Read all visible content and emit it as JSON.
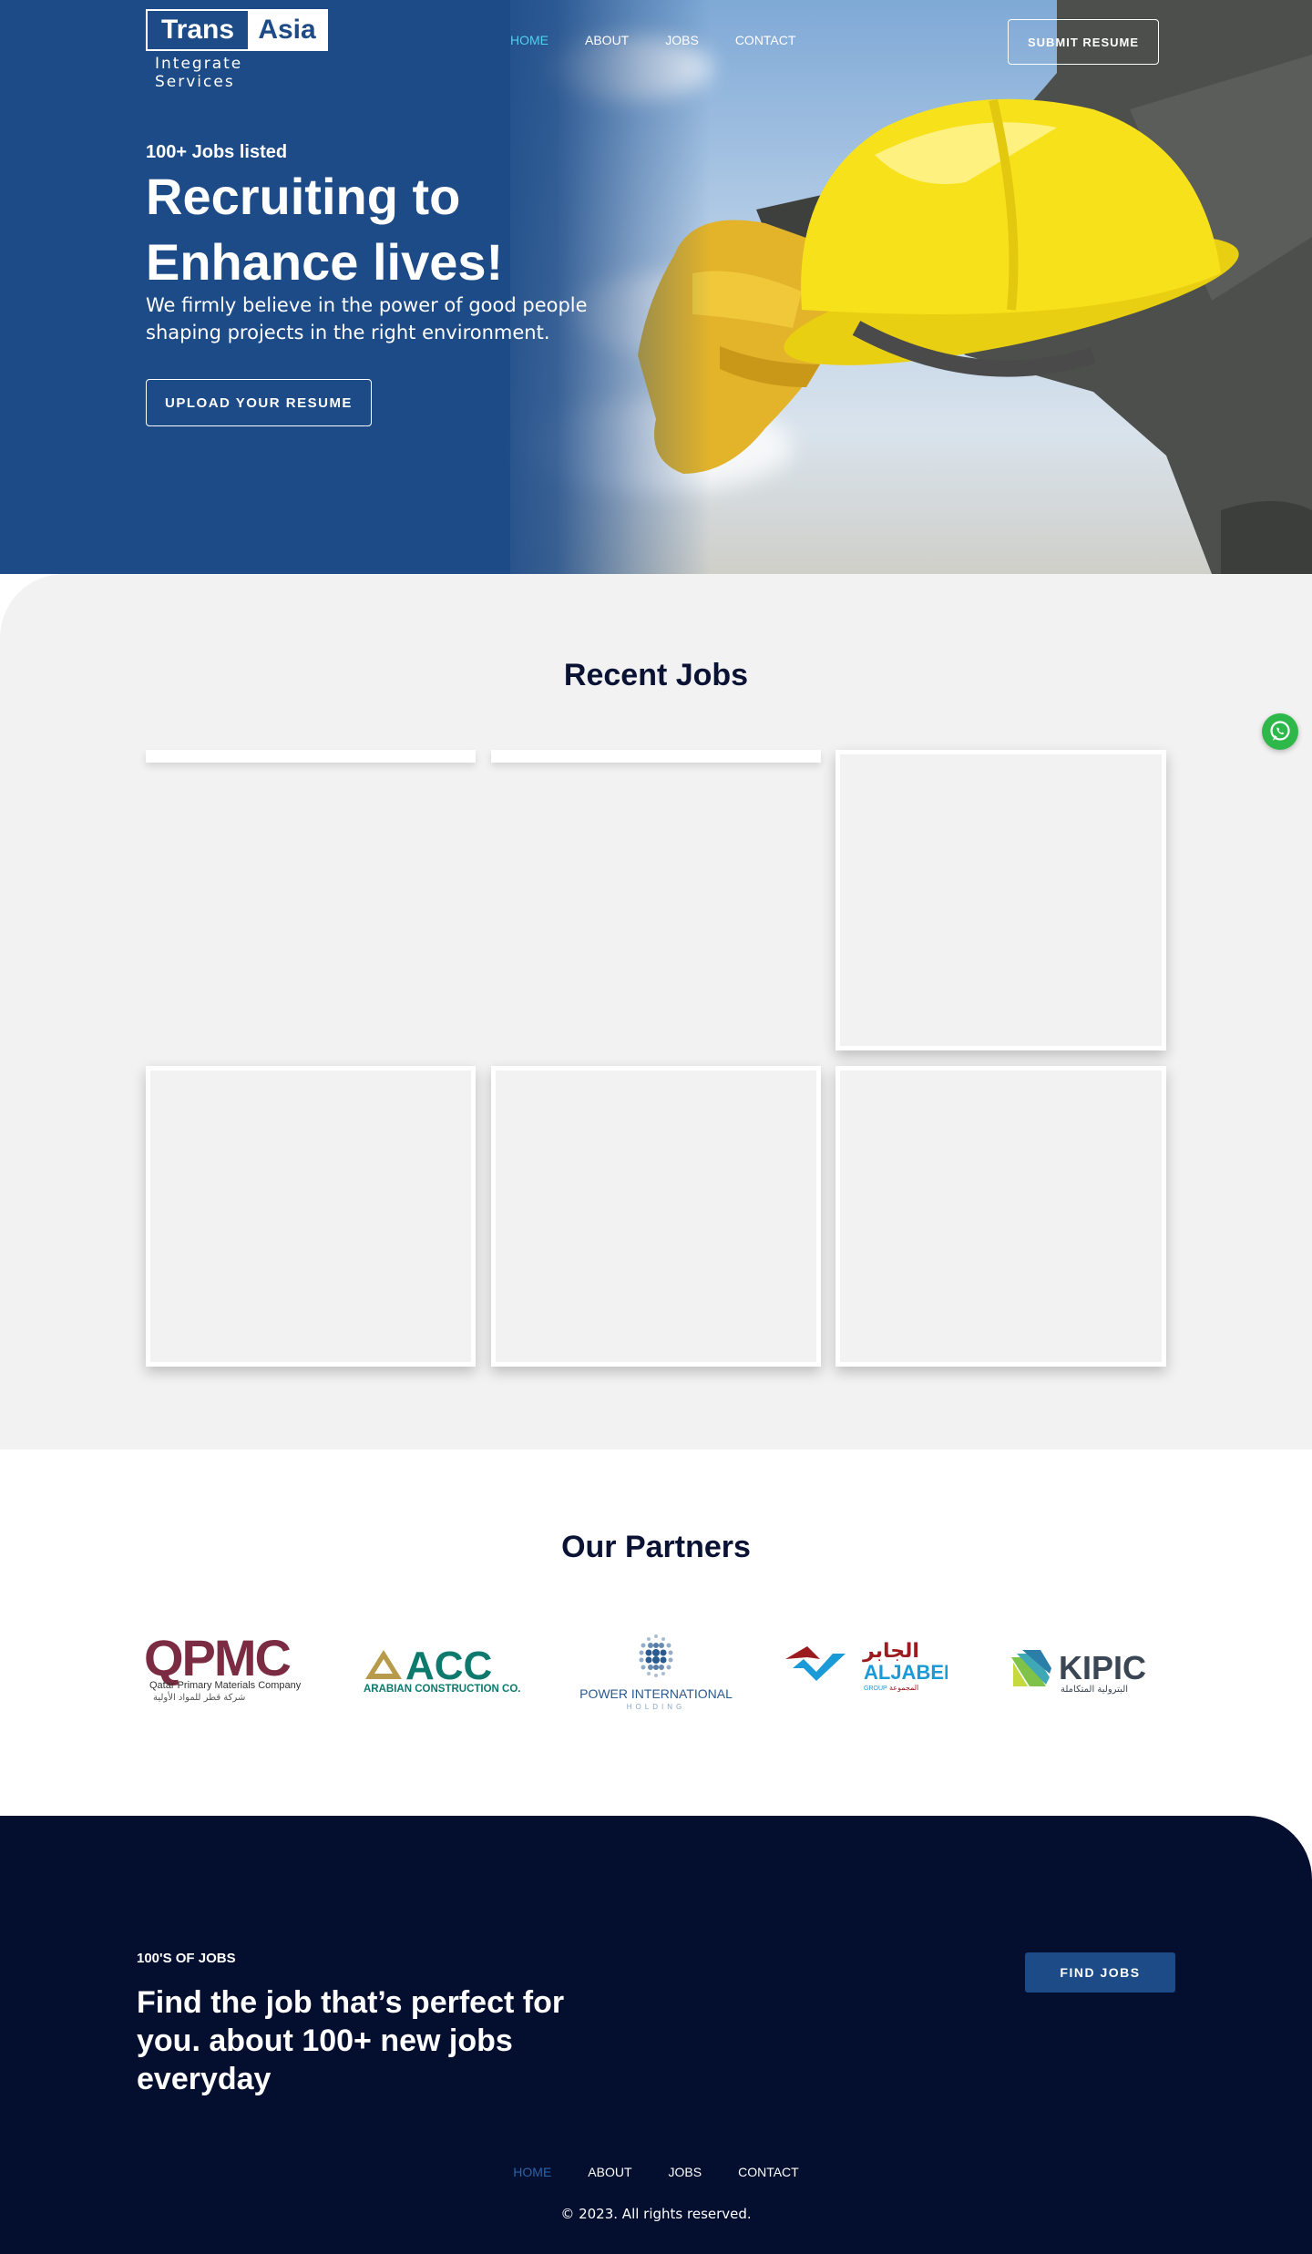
{
  "brand": {
    "logo_left": "Trans",
    "logo_right": "Asia",
    "tagline": "Integrate Services"
  },
  "nav": {
    "items": [
      {
        "label": "HOME",
        "active": true
      },
      {
        "label": "ABOUT",
        "active": false
      },
      {
        "label": "JOBS",
        "active": false
      },
      {
        "label": "CONTACT",
        "active": false
      }
    ]
  },
  "header": {
    "submit_label": "SUBMIT RESUME"
  },
  "hero": {
    "eyebrow": "100+ Jobs listed",
    "title": "Recruiting to Enhance lives!",
    "text": "We firmly believe in the power of good people shaping projects in the right environment.",
    "upload_label": "UPLOAD YOUR RESUME"
  },
  "jobs": {
    "title": "Recent Jobs"
  },
  "partners": {
    "title": "Our Partners",
    "logos": [
      {
        "name": "QPMC",
        "subtitle": "Qatar Primary Materials Company",
        "arabic": "شركة قطر للمواد الأولية"
      },
      {
        "name": "ACC",
        "subtitle": "ARABIAN CONSTRUCTION CO."
      },
      {
        "name": "POWER INTERNATIONAL",
        "subtitle": "HOLDING"
      },
      {
        "name": "ALJABER",
        "arabic": "الجابر",
        "subtitle": "GROUP",
        "arabic_sub": "المجموعة"
      },
      {
        "name": "KIPIC",
        "arabic": "البترولية المتكاملة"
      }
    ]
  },
  "cta": {
    "eyebrow": "100'S OF JOBS",
    "title": "Find the job that’s perfect for you. about 100+ new jobs everyday",
    "find_label": "FIND JOBS"
  },
  "footer": {
    "nav": [
      {
        "label": "HOME",
        "active": true
      },
      {
        "label": "ABOUT",
        "active": false
      },
      {
        "label": "JOBS",
        "active": false
      },
      {
        "label": "CONTACT",
        "active": false
      }
    ],
    "copyright": "© 2023. All rights reserved."
  },
  "colors": {
    "brand_blue": "#1d4b87",
    "nav_active": "#4fd0ec",
    "footer_bg": "#040e2e",
    "jobs_bg": "#f2f2f2",
    "heading": "#0b1334",
    "whatsapp": "#2fb84a"
  },
  "icons": {
    "whatsapp": "whatsapp-icon"
  }
}
